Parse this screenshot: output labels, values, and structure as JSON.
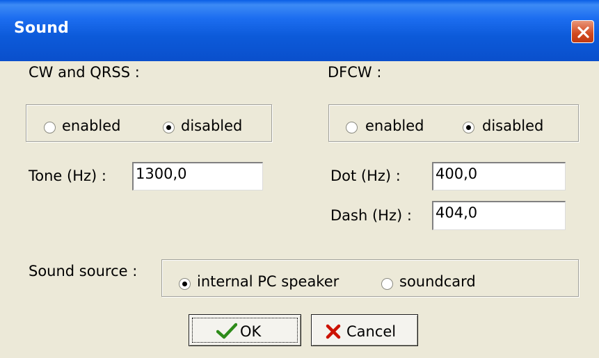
{
  "window": {
    "title": "Sound"
  },
  "cw": {
    "label": "CW and QRSS :",
    "enabled_label": "enabled",
    "disabled_label": "disabled",
    "selected": "disabled",
    "tone_label": "Tone (Hz) :",
    "tone_value": "1300,0"
  },
  "dfcw": {
    "label": "DFCW :",
    "enabled_label": "enabled",
    "disabled_label": "disabled",
    "selected": "disabled",
    "dot_label": "Dot (Hz) :",
    "dot_value": "400,0",
    "dash_label": "Dash (Hz) :",
    "dash_value": "404,0"
  },
  "sound_source": {
    "label": "Sound source :",
    "options": [
      "internal PC speaker",
      "soundcard"
    ],
    "selected": "internal PC speaker"
  },
  "buttons": {
    "ok_label": "OK",
    "cancel_label": "Cancel"
  },
  "icons": {
    "close": "close-icon",
    "ok": "checkmark-icon",
    "cancel": "x-icon"
  },
  "colors": {
    "titlebar": "#0c5ad9",
    "face": "#ece9d8",
    "close": "#d2491f",
    "check": "#2e8b1a",
    "cancel": "#cc1100"
  }
}
